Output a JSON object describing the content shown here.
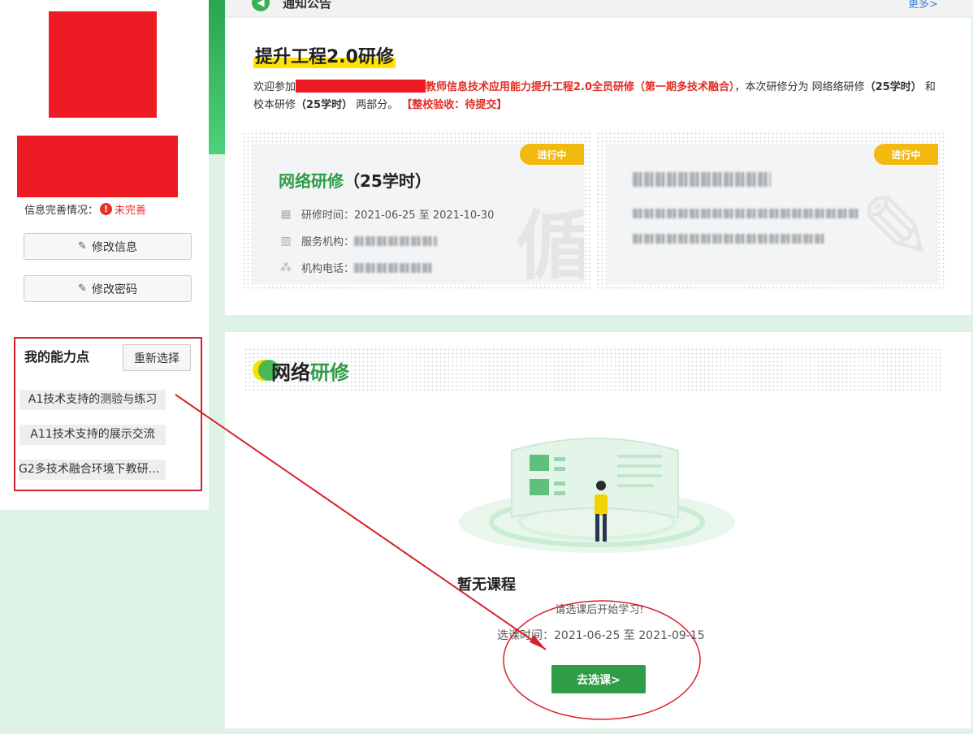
{
  "notice": {
    "title": "通知公告",
    "more": "更多>"
  },
  "profile": {
    "info_label": "信息完善情况：",
    "info_status": "未完善",
    "edit_info": "修改信息",
    "edit_password": "修改密码"
  },
  "abilities": {
    "title": "我的能力点",
    "reselect": "重新选择",
    "items": [
      "A1技术支持的测验与练习",
      "A11技术支持的展示交流",
      "G2多技术融合环境下教研..."
    ]
  },
  "project": {
    "title": "提升工程2.0研修",
    "desc_prefix": "欢迎参加",
    "desc_red": "教师信息技术应用能力提升工程2.0全员研修（第一期多技术融合）",
    "desc_mid": "，本次研修分为 网络络研修",
    "desc_b1": "（25学时）",
    "desc_and": " 和 校本研修",
    "desc_b2": "（25学时）",
    "desc_tail": " 两部分。",
    "desc_status": "【整校验收：待提交】"
  },
  "online_card": {
    "badge": "进行中",
    "title_green": "网络研修",
    "title_hours": "（25学时）",
    "time_label": "研修时间：",
    "time_value": "2021-06-25 至 2021-10-30",
    "org_label": "服务机构：",
    "phone_label": "机构电话："
  },
  "school_card": {
    "badge": "进行中"
  },
  "course_section": {
    "title_black": "网络",
    "title_green": "研修",
    "empty_title": "暂无课程",
    "empty_sub": "请选课后开始学习!",
    "select_time_label": "选课时间：",
    "select_time_value": "2021-06-25 至 2021-09-15",
    "go_button": "去选课>"
  },
  "colors": {
    "accent_green": "#2f9c48",
    "badge_yellow": "#f2b90f",
    "alert_red": "#e02d24",
    "annotation_red": "#d7212b"
  }
}
